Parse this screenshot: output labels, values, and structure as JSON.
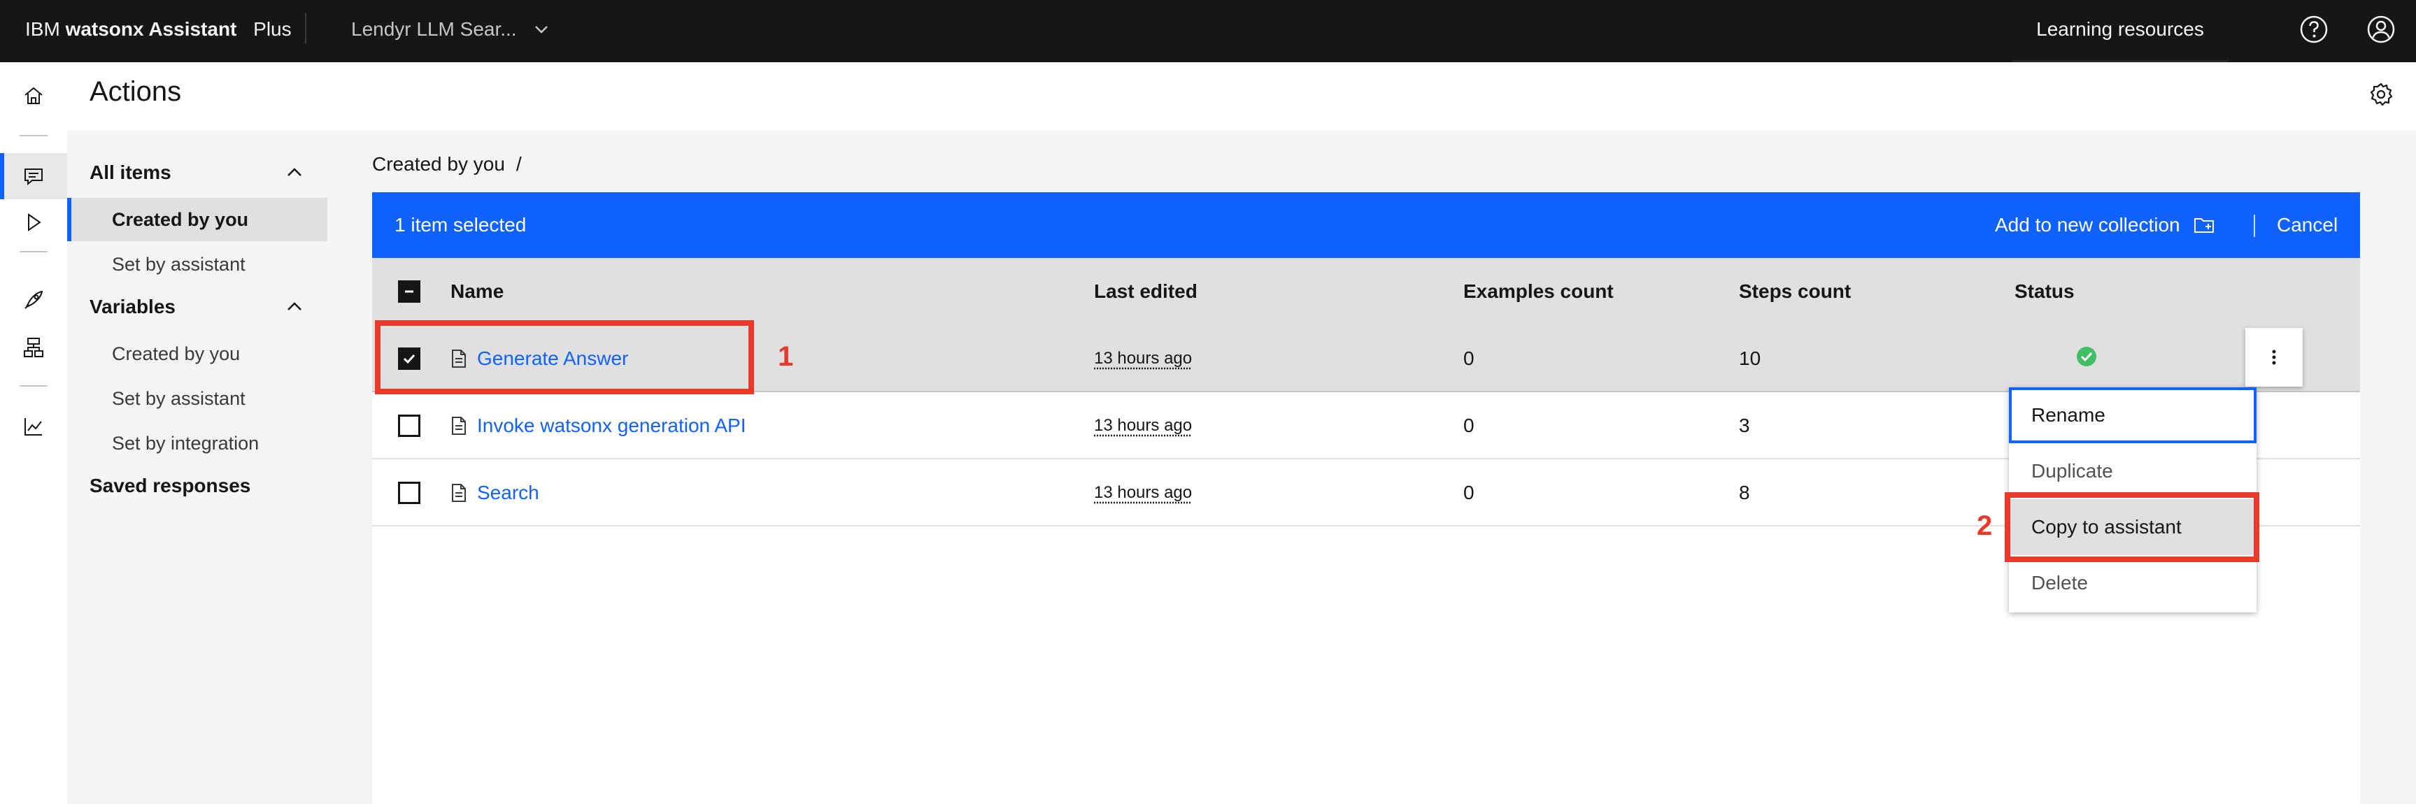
{
  "topbar": {
    "brand_ibm": "IBM",
    "brand_product": "watsonx Assistant",
    "brand_plan": "Plus",
    "assistant_name": "Lendyr LLM Sear...",
    "learning_resources": "Learning resources"
  },
  "header": {
    "title": "Actions"
  },
  "sidenav": {
    "all_items": "All items",
    "all_items_children": [
      "Created by you",
      "Set by assistant"
    ],
    "variables": "Variables",
    "variables_children": [
      "Created by you",
      "Set by assistant",
      "Set by integration"
    ],
    "saved_responses": "Saved responses"
  },
  "breadcrumb": {
    "label": "Created by you",
    "separator": "/"
  },
  "batch_actions": {
    "count": "1 item selected",
    "add_collection": "Add to new collection",
    "cancel": "Cancel"
  },
  "table": {
    "columns": [
      "Name",
      "Last edited",
      "Examples count",
      "Steps count",
      "Status"
    ],
    "rows": [
      {
        "name": "Generate Answer",
        "last_edited": "13 hours ago",
        "examples": "0",
        "steps": "10",
        "selected": true,
        "status": "ok"
      },
      {
        "name": "Invoke watsonx generation API",
        "last_edited": "13 hours ago",
        "examples": "0",
        "steps": "3",
        "selected": false,
        "status": ""
      },
      {
        "name": "Search",
        "last_edited": "13 hours ago",
        "examples": "0",
        "steps": "8",
        "selected": false,
        "status": ""
      }
    ]
  },
  "overflow_menu": {
    "items": [
      "Rename",
      "Duplicate",
      "Copy to assistant",
      "Delete"
    ]
  },
  "annotations": {
    "first": "1",
    "second": "2"
  },
  "colors": {
    "accent": "#0f62fe",
    "annotation": "#e8392a",
    "success": "#42be65",
    "topbar": "#161616"
  }
}
